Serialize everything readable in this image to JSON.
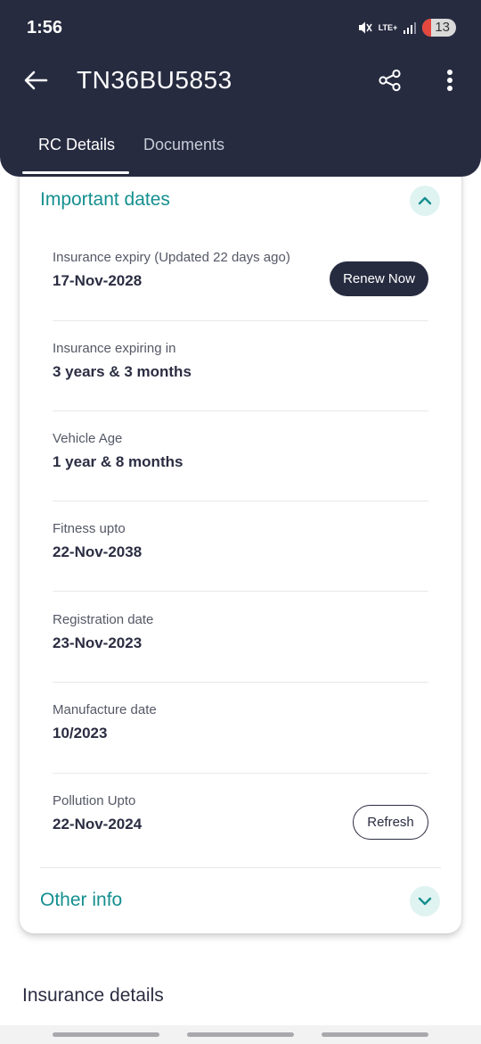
{
  "status_bar": {
    "time": "1:56",
    "network": "LTE+",
    "battery": "13",
    "icons": [
      "mute-icon",
      "signal-icon",
      "battery-icon"
    ]
  },
  "header": {
    "title": "TN36BU5853",
    "icons": [
      "back-arrow-icon",
      "share-icon",
      "more-vert-icon"
    ]
  },
  "tabs": [
    {
      "label": "RC Details",
      "active": true
    },
    {
      "label": "Documents",
      "active": false
    }
  ],
  "important_dates": {
    "heading": "Important dates",
    "expanded": true,
    "rows": [
      {
        "label": "Insurance expiry (Updated 22 days ago)",
        "value": "17-Nov-2028"
      },
      {
        "label": "Insurance expiring in",
        "value": "3 years & 3 months"
      },
      {
        "label": "Vehicle Age",
        "value": "1 year & 8 months"
      },
      {
        "label": "Fitness upto",
        "value": "22-Nov-2038"
      },
      {
        "label": "Registration date",
        "value": "23-Nov-2023"
      },
      {
        "label": "Manufacture date",
        "value": "10/2023"
      },
      {
        "label": "Pollution Upto",
        "value": "22-Nov-2024"
      }
    ],
    "renew_button": "Renew Now",
    "refresh_button": "Refresh"
  },
  "other_info": {
    "heading": "Other info",
    "expanded": false
  },
  "insurance_details": {
    "heading": "Insurance details"
  },
  "colors": {
    "header_bg": "#262b40",
    "accent_teal": "#158f8f",
    "toggle_bg": "#dff3f1"
  }
}
